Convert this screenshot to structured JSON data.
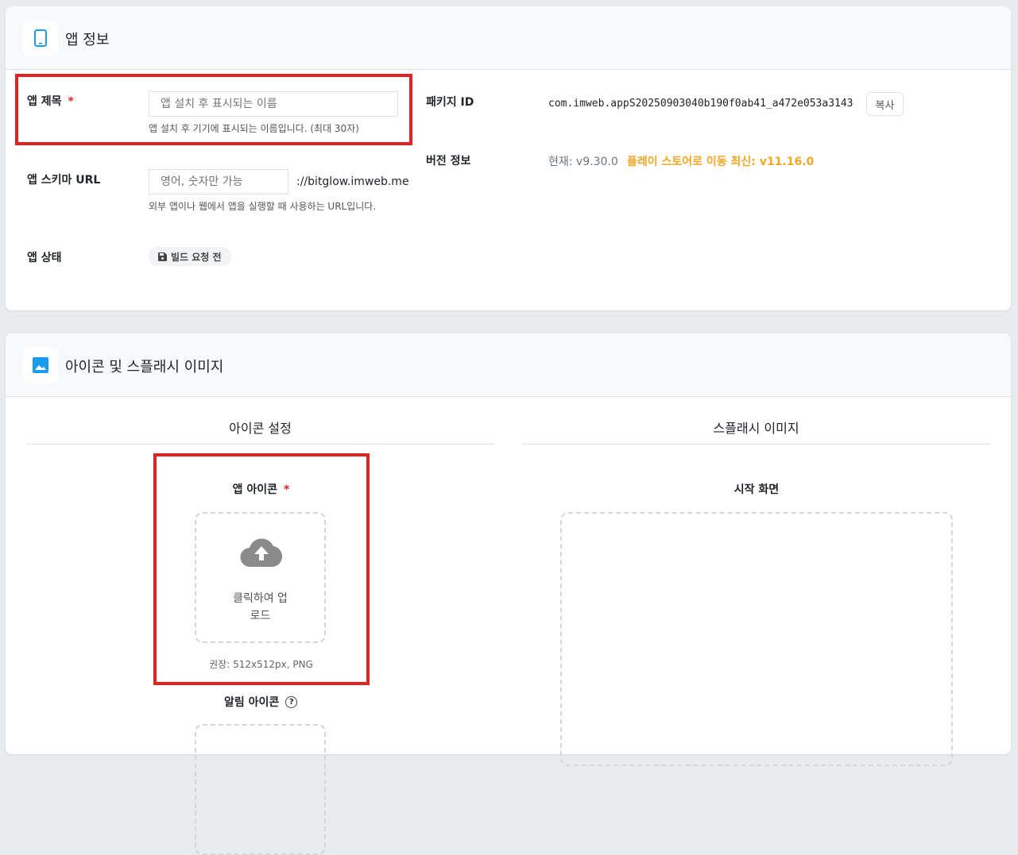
{
  "app_info": {
    "title": "앱 정보",
    "icon": "mobile-phone-icon",
    "app_title": {
      "label": "앱 제목",
      "required": "*",
      "placeholder": "앱 설치 후 표시되는 이름",
      "value": "",
      "help": "앱 설치 후 기기에 표시되는 이름입니다. (최대 30자)"
    },
    "scheme_url": {
      "label": "앱 스키마 URL",
      "placeholder": "영어, 숫자만 가능",
      "value": "",
      "suffix": "://bitglow.imweb.me",
      "help": "외부 앱이나 웹에서 앱을 실행할 때 사용하는 URL입니다."
    },
    "app_status": {
      "label": "앱 상태",
      "badge": "빌드 요청 전",
      "badge_icon": "floppy-disk-icon"
    },
    "package_id": {
      "label": "패키지 ID",
      "value": "com.imweb.appS20250903040b190f0ab41_a472e053a3143",
      "copy_label": "복사"
    },
    "version": {
      "label": "버전 정보",
      "current": "현재: v9.30.0",
      "latest_link": "플레이 스토어로 이동 최신: v11.16.0"
    }
  },
  "images": {
    "title": "아이콘 및 스플래시 이미지",
    "icon": "image-icon",
    "icon_settings": {
      "title": "아이콘 설정",
      "app_icon": {
        "label": "앱 아이콘",
        "required": "*",
        "upload_line1": "클릭하여 업",
        "upload_line2": "로드",
        "hint": "권장: 512x512px, PNG"
      },
      "notification_icon": {
        "label": "알림 아이콘"
      }
    },
    "splash": {
      "title": "스플래시 이미지",
      "start_screen": {
        "label": "시작 화면"
      }
    }
  },
  "colors": {
    "accent": "#f5a623",
    "highlight": "#e52222",
    "brand": "#1a9bf0"
  }
}
